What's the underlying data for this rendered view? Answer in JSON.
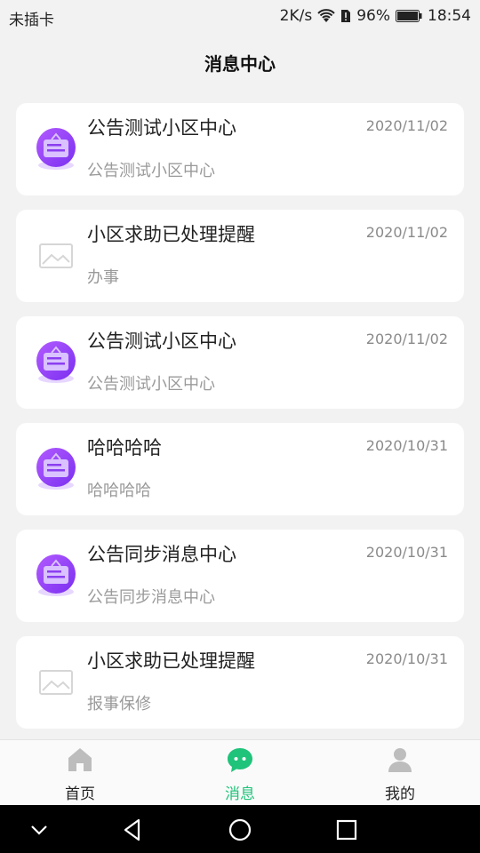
{
  "status_bar": {
    "carrier": "未插卡",
    "speed": "2K/s",
    "battery": "96%",
    "time": "18:54"
  },
  "page_title": "消息中心",
  "messages": [
    {
      "title": "公告测试小区中心",
      "date": "2020/11/02",
      "subtitle": "公告测试小区中心",
      "icon": "announcement-icon"
    },
    {
      "title": "小区求助已处理提醒",
      "date": "2020/11/02",
      "subtitle": "办事",
      "icon": "image-placeholder-icon"
    },
    {
      "title": "公告测试小区中心",
      "date": "2020/11/02",
      "subtitle": "公告测试小区中心",
      "icon": "announcement-icon"
    },
    {
      "title": "哈哈哈哈",
      "date": "2020/10/31",
      "subtitle": "哈哈哈哈",
      "icon": "announcement-icon"
    },
    {
      "title": "公告同步消息中心",
      "date": "2020/10/31",
      "subtitle": "公告同步消息中心",
      "icon": "announcement-icon"
    },
    {
      "title": "小区求助已处理提醒",
      "date": "2020/10/31",
      "subtitle": "报事保修",
      "icon": "image-placeholder-icon"
    }
  ],
  "tabs": [
    {
      "label": "首页",
      "icon": "home-icon"
    },
    {
      "label": "消息",
      "icon": "chat-bubble-icon"
    },
    {
      "label": "我的",
      "icon": "user-icon"
    }
  ],
  "colors": {
    "accent": "#1fc37a",
    "announcement_purple": "#8b3ff0"
  }
}
